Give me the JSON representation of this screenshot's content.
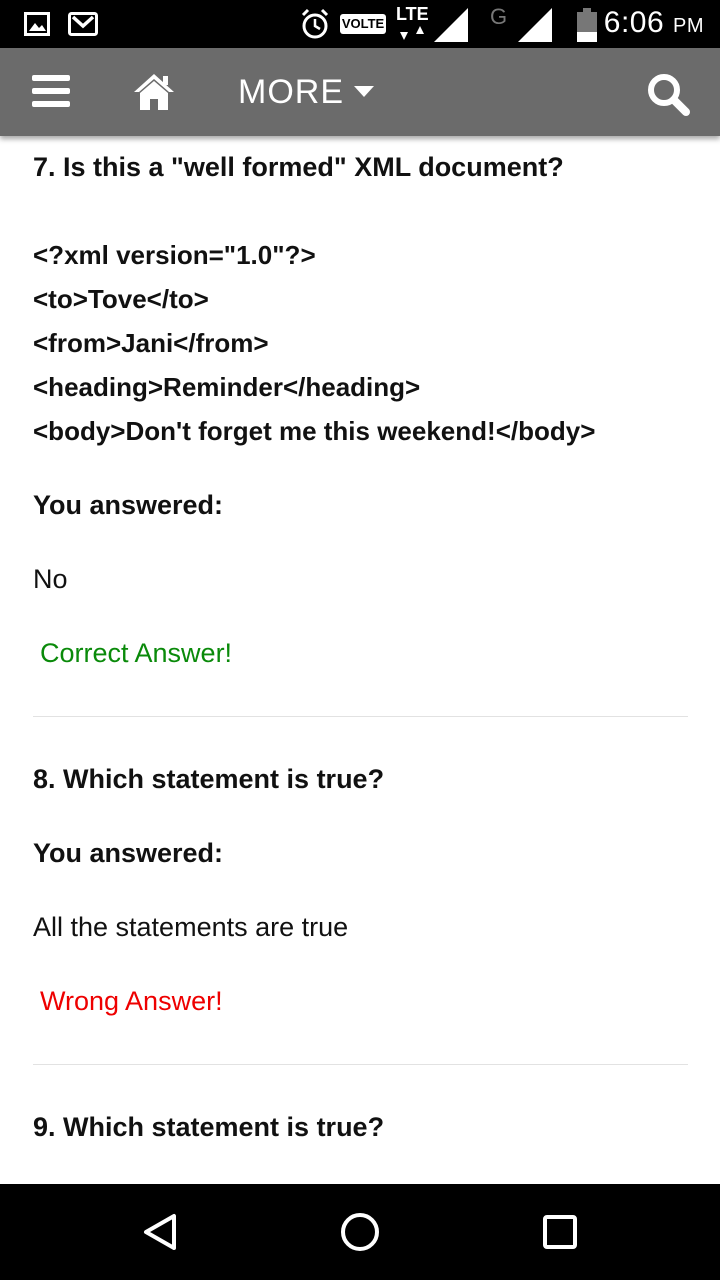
{
  "status_bar": {
    "network_badge": "VOLTE",
    "lte_label": "LTE",
    "g_label": "G",
    "time": "6:06",
    "ampm": "PM",
    "icons": [
      "image-notification-icon",
      "gmail-icon",
      "alarm-icon",
      "signal-icon",
      "battery-icon"
    ]
  },
  "app_bar": {
    "more_label": "MORE",
    "icons": [
      "menu-icon",
      "home-icon",
      "caret-down-icon",
      "search-icon"
    ],
    "background": "#6b6b6b"
  },
  "questions": [
    {
      "title": "7. Is this a \"well formed\" XML document?",
      "code": [
        "<?xml version=\"1.0\"?>",
        "<to>Tove</to>",
        "<from>Jani</from>",
        "<heading>Reminder</heading>",
        "<body>Don't forget me this weekend!</body>"
      ],
      "answered_label": "You answered:",
      "answer": "No",
      "result": "Correct Answer!",
      "result_color": "#0a8a0a"
    },
    {
      "title": "8. Which statement is true?",
      "answered_label": "You answered:",
      "answer": "All the statements are true",
      "result": "Wrong Answer!",
      "result_color": "#ee0000"
    },
    {
      "title": "9. Which statement is true?"
    }
  ],
  "nav_bar": {
    "icons": [
      "back-icon",
      "home-circle-icon",
      "recents-icon"
    ]
  }
}
